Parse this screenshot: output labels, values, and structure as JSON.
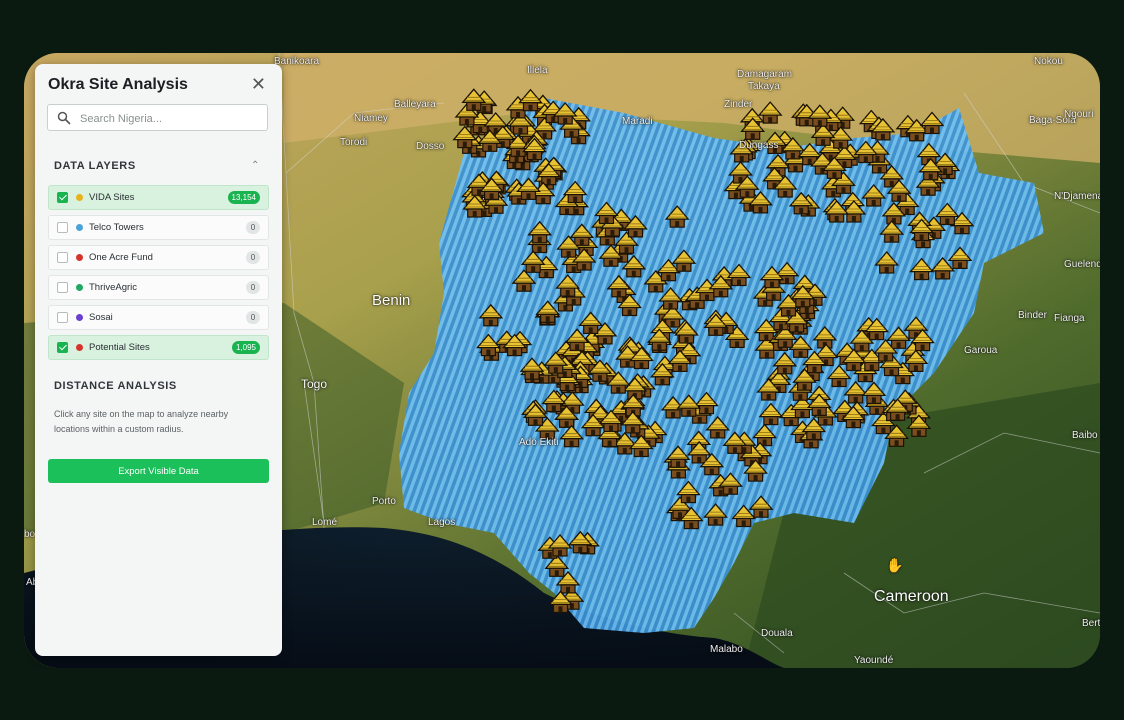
{
  "panel": {
    "title": "Okra Site Analysis",
    "close_icon": "close-icon",
    "search": {
      "placeholder": "Search Nigeria...",
      "value": "",
      "icon": "search-icon"
    },
    "data_layers": {
      "heading": "DATA LAYERS",
      "collapse_icon": "chevron-up-icon",
      "items": [
        {
          "label": "VIDA Sites",
          "count": "13,154",
          "checked": true,
          "color": "#e8b21b"
        },
        {
          "label": "Telco Towers",
          "count": "0",
          "checked": false,
          "color": "#4aa3d8"
        },
        {
          "label": "One Acre Fund",
          "count": "0",
          "checked": false,
          "color": "#d6342b"
        },
        {
          "label": "ThriveAgric",
          "count": "0",
          "checked": false,
          "color": "#1eaa62"
        },
        {
          "label": "Sosai",
          "count": "0",
          "checked": false,
          "color": "#6a3fd1"
        },
        {
          "label": "Potential Sites",
          "count": "1,095",
          "checked": true,
          "color": "#d6342b"
        }
      ]
    },
    "distance": {
      "heading": "DISTANCE ANALYSIS",
      "description": "Click any site on the map to analyze nearby locations within a custom radius."
    },
    "export_label": "Export Visible Data"
  },
  "map": {
    "labels": {
      "benin": "Benin",
      "togo": "Togo",
      "cameroon": "Cameroon",
      "banikoara": "Banikoara",
      "niamey": "Niamey",
      "dosso": "Dosso",
      "torodi": "Torodi",
      "balleyara": "Balleyara",
      "illela": "Illela",
      "maradi": "Maradi",
      "damagaram": "Damagaram",
      "takaya": "Takaya",
      "zinder": "Zinder",
      "dungass": "Dungass",
      "nokou": "Nokou",
      "bagasola": "Baga-Sola",
      "ngouri": "Ngouri",
      "djamena": "N'Djamena",
      "guelendeng": "Guelendeng",
      "binder": "Binder",
      "fianga": "Fianga",
      "garoua": "Garoua",
      "baibo": "Baibo",
      "lome": "Lomé",
      "porto": "Porto",
      "lagos": "Lagos",
      "adoekiti": "Ado Ekiti",
      "douala": "Douala",
      "malabo": "Malabo",
      "yaounde": "Yaoundé",
      "bert": "Bert",
      "ab": "Ab",
      "bo": "bo"
    },
    "marker_icon": "hut-marker-icon",
    "coverage_color": "#4fa9ee",
    "cursor_icon": "hand-cursor-icon"
  }
}
